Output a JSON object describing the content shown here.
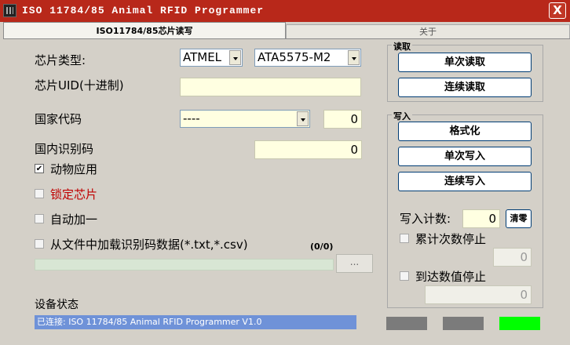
{
  "window": {
    "title": "ISO 11784/85 Animal RFID Programmer",
    "close_label": "X"
  },
  "tabs": [
    {
      "label": "ISO11784/85芯片读写"
    },
    {
      "label": "关于"
    }
  ],
  "form": {
    "chip_type_label": "芯片类型:",
    "chip_vendor": "ATMEL",
    "chip_model": "ATA5575-M2",
    "chip_uid_label": "芯片UID(十进制)",
    "chip_uid_value": "",
    "country_code_label": "国家代码",
    "country_code_select": "----",
    "country_code_value": "0",
    "national_id_label": "国内识别码",
    "national_id_value": "0",
    "animal_app_label": "动物应用",
    "animal_app_checked": true,
    "lock_chip_label": "锁定芯片",
    "lock_chip_checked": false,
    "auto_increment_label": "自动加一",
    "auto_increment_checked": false,
    "load_file_label": "从文件中加载识别码数据(*.txt,*.csv)",
    "load_file_checked": false,
    "file_progress": "(0/0)",
    "file_progress_fraction": 0,
    "browse_label": "..."
  },
  "read_group": {
    "title": "读取",
    "single_read": "单次读取",
    "continuous_read": "连续读取"
  },
  "write_group": {
    "title": "写入",
    "format": "格式化",
    "single_write": "单次写入",
    "continuous_write": "连续写入",
    "count_label": "写入计数:",
    "count_value": "0",
    "clear_label": "清零",
    "accumulate_stop_label": "累计次数停止",
    "accumulate_stop_checked": false,
    "accumulate_value": "0",
    "reach_stop_label": "到达数值停止",
    "reach_stop_checked": false,
    "reach_value": "0"
  },
  "status": {
    "label": "设备状态",
    "text": "已连接: ISO 11784/85 Animal RFID Programmer V1.0",
    "indicators": [
      {
        "color": "#7b7b7b"
      },
      {
        "color": "#7b7b7b"
      },
      {
        "color": "#00ff00"
      }
    ]
  },
  "colors": {
    "title_bar": "#b8281a",
    "status_bar": "#6f92d8",
    "input_bg": "#ffffe1",
    "lock_label": "#c00000"
  }
}
